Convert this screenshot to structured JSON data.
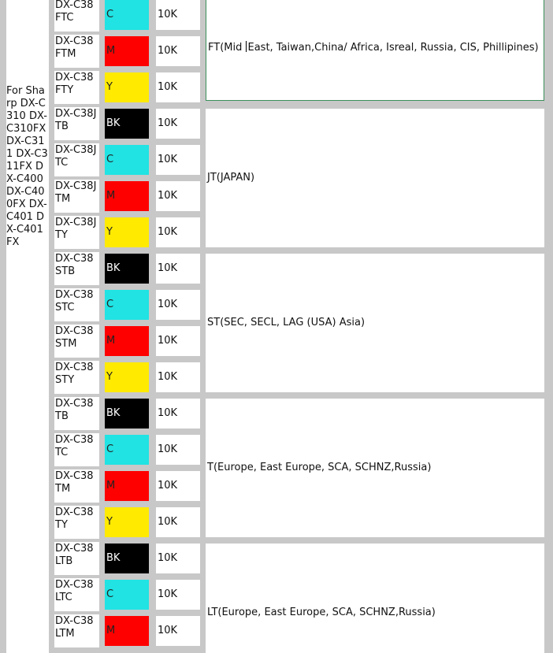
{
  "model_text": "For Sharp DX-C310 DX-C310FX DX-C311 DX-C311FX DX-C400 DX-C400FX DX-C401 DX-C401FX",
  "rows": [
    {
      "code": "DX-C38FTC",
      "color": "C",
      "color_hex": "#21e3e3",
      "yield": "10K"
    },
    {
      "code": "DX-C38FTM",
      "color": "M",
      "color_hex": "#ff0000",
      "yield": "10K"
    },
    {
      "code": "DX-C38FTY",
      "color": "Y",
      "color_hex": "#ffea00",
      "yield": "10K"
    },
    {
      "code": "DX-C38JTB",
      "color": "BK",
      "color_hex": "#000000",
      "yield": "10K"
    },
    {
      "code": "DX-C38JTC",
      "color": "C",
      "color_hex": "#21e3e3",
      "yield": "10K"
    },
    {
      "code": "DX-C38JTM",
      "color": "M",
      "color_hex": "#ff0000",
      "yield": "10K"
    },
    {
      "code": "DX-C38JTY",
      "color": "Y",
      "color_hex": "#ffea00",
      "yield": "10K"
    },
    {
      "code": "DX-C38STB",
      "color": "BK",
      "color_hex": "#000000",
      "yield": "10K"
    },
    {
      "code": "DX-C38STC",
      "color": "C",
      "color_hex": "#21e3e3",
      "yield": "10K"
    },
    {
      "code": "DX-C38STM",
      "color": "M",
      "color_hex": "#ff0000",
      "yield": "10K"
    },
    {
      "code": "DX-C38STY",
      "color": "Y",
      "color_hex": "#ffea00",
      "yield": "10K"
    },
    {
      "code": "DX-C38TB",
      "color": "BK",
      "color_hex": "#000000",
      "yield": "10K"
    },
    {
      "code": "DX-C38TC",
      "color": "C",
      "color_hex": "#21e3e3",
      "yield": "10K"
    },
    {
      "code": "DX-C38TM",
      "color": "M",
      "color_hex": "#ff0000",
      "yield": "10K"
    },
    {
      "code": "DX-C38TY",
      "color": "Y",
      "color_hex": "#ffea00",
      "yield": "10K"
    },
    {
      "code": "DX-C38LTB",
      "color": "BK",
      "color_hex": "#000000",
      "yield": "10K"
    },
    {
      "code": "DX-C38LTC",
      "color": "C",
      "color_hex": "#21e3e3",
      "yield": "10K"
    },
    {
      "code": "DX-C38LTM",
      "color": "M",
      "color_hex": "#ff0000",
      "yield": "10K"
    }
  ],
  "regions": [
    {
      "text_before": "FT(Mid ",
      "text_after": "East, Taiwan,China/ Africa, Isreal, Russia, CIS, Phillipines)",
      "rows": 3,
      "selected": true
    },
    {
      "text": "JT(JAPAN)",
      "rows": 4
    },
    {
      "text": "ST(SEC, SECL, LAG  (USA)  Asia)",
      "rows": 4
    },
    {
      "text": "T(Europe, East Europe, SCA, SCHNZ,Russia)",
      "rows": 4
    },
    {
      "text": "LT(Europe, East Europe, SCA, SCHNZ,Russia)",
      "rows": 4
    }
  ]
}
